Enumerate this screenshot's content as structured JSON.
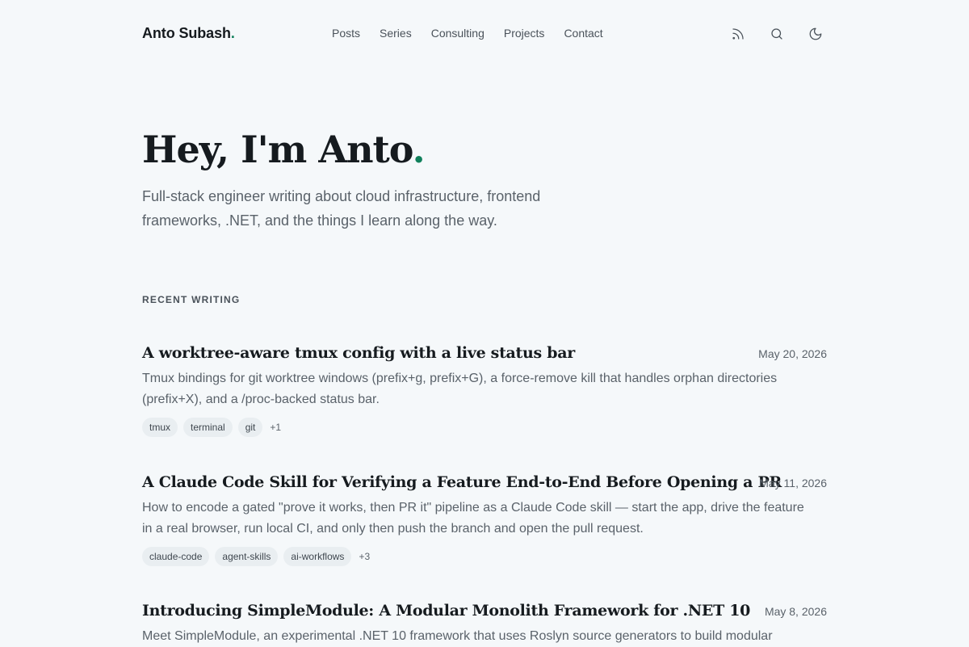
{
  "header": {
    "brand": "Anto Subash",
    "brand_dot": ".",
    "nav": [
      "Posts",
      "Series",
      "Consulting",
      "Projects",
      "Contact"
    ],
    "icons": [
      "rss-icon",
      "search-icon",
      "moon-icon"
    ]
  },
  "hero": {
    "title": "Hey, I'm Anto",
    "title_dot": ".",
    "subtitle": "Full-stack engineer writing about cloud infrastructure, frontend frameworks, .NET, and the things I learn along the way."
  },
  "section_label": "RECENT WRITING",
  "posts": [
    {
      "title": "A worktree-aware tmux config with a live status bar",
      "date": "May 20, 2026",
      "excerpt": "Tmux bindings for git worktree windows (prefix+g, prefix+G), a force-remove kill that handles orphan directories (prefix+X), and a /proc-backed status bar.",
      "tags": [
        "tmux",
        "terminal",
        "git"
      ],
      "more": "+1"
    },
    {
      "title": "A Claude Code Skill for Verifying a Feature End-to-End Before Opening a PR",
      "date": "May 11, 2026",
      "excerpt": "How to encode a gated \"prove it works, then PR it\" pipeline as a Claude Code skill — start the app, drive the feature in a real browser, run local CI, and only then push the branch and open the pull request.",
      "tags": [
        "claude-code",
        "agent-skills",
        "ai-workflows"
      ],
      "more": "+3"
    },
    {
      "title": "Introducing SimpleModule: A Modular Monolith Framework for .NET 10",
      "date": "May 8, 2026",
      "excerpt": "Meet SimpleModule, an experimental .NET 10 framework that uses Roslyn source generators to build modular",
      "tags": [],
      "more": ""
    }
  ],
  "colors": {
    "accent": "#10805b",
    "background": "#f5f8fa",
    "tag_bg": "#e9eef1"
  }
}
